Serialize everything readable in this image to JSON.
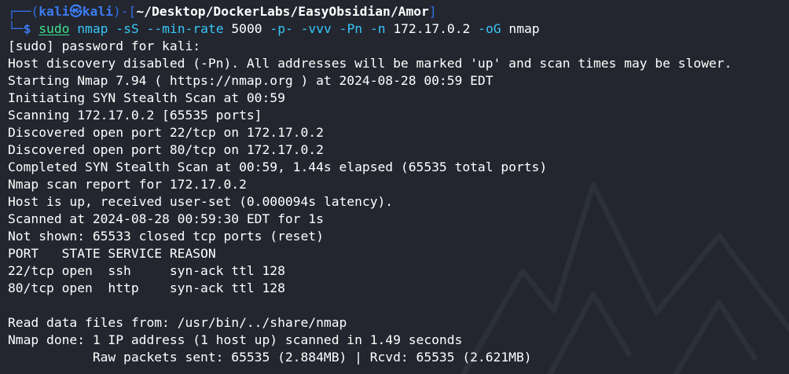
{
  "theme": {
    "background": "#23262f",
    "prompt_frame_color": "#2f6fe6",
    "user_host_color": "#3b7bf0",
    "path_color": "#ffffff",
    "command_color": "#3ee08a",
    "argument_color": "#39c6f7"
  },
  "prompt": {
    "frame_top_left": "┌──(",
    "user": "kali",
    "at_symbol": "㉿",
    "host": "kali",
    "frame_mid": ")-[",
    "path": "~/Desktop/DockerLabs/EasyObsidian/Amor",
    "frame_end": "]",
    "frame_bottom_left": "└─",
    "dollar": "$ "
  },
  "command": {
    "sudo": "sudo",
    "nmap": "nmap",
    "flag_sS": "-sS",
    "flag_min_rate": "--min-rate",
    "min_rate_value": "5000",
    "flag_p": "-p-",
    "flag_vvv": "-vvv",
    "flag_Pn": "-Pn",
    "flag_n": "-n",
    "target": "172.17.0.2",
    "flag_oG": "-oG",
    "output_name": "nmap"
  },
  "output": [
    "[sudo] password for kali:",
    "Host discovery disabled (-Pn). All addresses will be marked 'up' and scan times may be slower.",
    "Starting Nmap 7.94 ( https://nmap.org ) at 2024-08-28 00:59 EDT",
    "Initiating SYN Stealth Scan at 00:59",
    "Scanning 172.17.0.2 [65535 ports]",
    "Discovered open port 22/tcp on 172.17.0.2",
    "Discovered open port 80/tcp on 172.17.0.2",
    "Completed SYN Stealth Scan at 00:59, 1.44s elapsed (65535 total ports)",
    "Nmap scan report for 172.17.0.2",
    "Host is up, received user-set (0.000094s latency).",
    "Scanned at 2024-08-28 00:59:30 EDT for 1s",
    "Not shown: 65533 closed tcp ports (reset)",
    "PORT   STATE SERVICE REASON",
    "22/tcp open  ssh     syn-ack ttl 128",
    "80/tcp open  http    syn-ack ttl 128",
    "",
    "Read data files from: /usr/bin/../share/nmap",
    "Nmap done: 1 IP address (1 host up) scanned in 1.49 seconds",
    "           Raw packets sent: 65535 (2.884MB) | Rcvd: 65535 (2.621MB)"
  ]
}
